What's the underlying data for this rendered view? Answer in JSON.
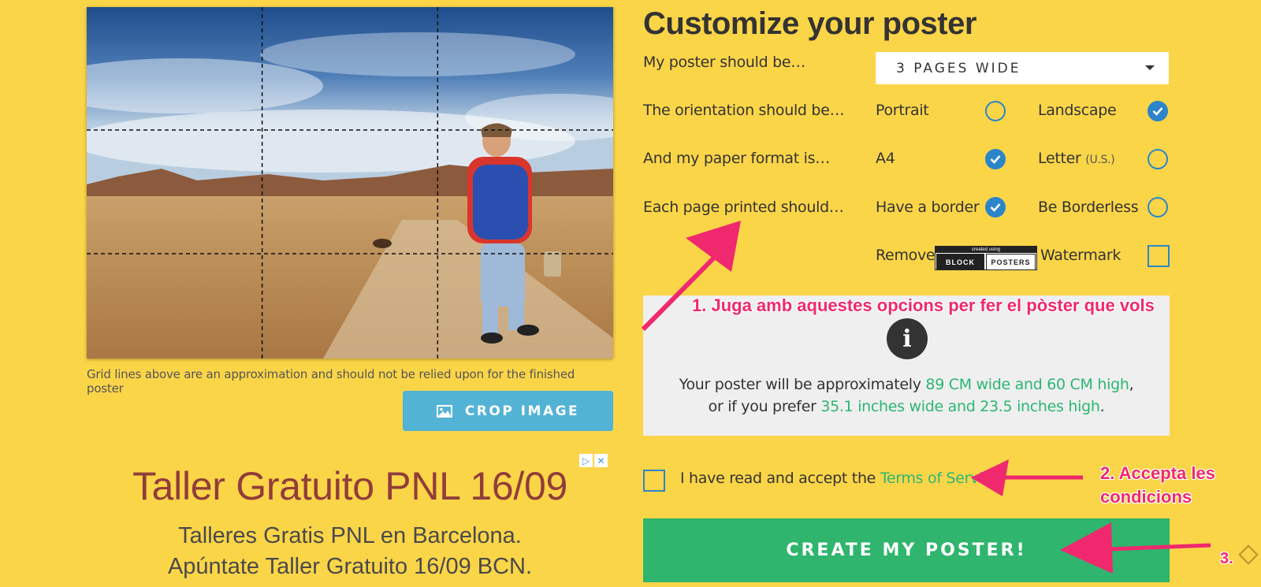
{
  "image": {
    "caption": "Grid lines above are an approximation and should not be relied upon for the finished poster",
    "crop_label": "CROP IMAGE",
    "crop_icon": "image-icon"
  },
  "ad": {
    "title": "Taller Gratuito PNL 16/09",
    "line1": "Talleres Gratis PNL en Barcelona.",
    "line2": "Apúntate Taller Gratuito 16/09 BCN.",
    "choices_icons": [
      "play-triangle-icon",
      "close-icon"
    ]
  },
  "customize": {
    "title": "Customize your poster",
    "size": {
      "label": "My poster should be…",
      "selected": "3 PAGES WIDE"
    },
    "orientation": {
      "label": "The orientation should be…",
      "option1": "Portrait",
      "option1_checked": false,
      "option2": "Landscape",
      "option2_checked": true
    },
    "paper": {
      "label": "And my paper format is…",
      "option1": "A4",
      "option1_checked": true,
      "option2": "Letter",
      "option2_note": "(U.S.)",
      "option2_checked": false
    },
    "border": {
      "label": "Each page printed should…",
      "option1": "Have a border",
      "option1_checked": true,
      "option2": "Be Borderless",
      "option2_checked": false
    },
    "watermark": {
      "remove": "Remove",
      "badge_top": "created using",
      "badge_left": "BLOCK",
      "badge_right": "POSTERS",
      "label": "Watermark",
      "checked": false
    }
  },
  "info": {
    "icon": "info-icon",
    "line1_prefix": "Your poster will be approximately ",
    "line1_highlight": "89 CM wide and 60 CM high",
    "line1_suffix": ",",
    "line2_prefix": "or if you prefer ",
    "line2_highlight": "35.1 inches wide and 23.5 inches high",
    "line2_suffix": "."
  },
  "terms": {
    "prefix": "I have read and accept the ",
    "link": "Terms of Service",
    "checked": false
  },
  "create_label": "CREATE MY POSTER!",
  "annotations": {
    "note1": "1. Juga amb aquestes opcions per fer el pòster que vols",
    "note2_line1": "2. Accepta les",
    "note2_line2": "condicions",
    "note3": "3."
  },
  "colors": {
    "background": "#fbd548",
    "accent_blue": "#2d85c9",
    "crop_button": "#52b3d5",
    "green": "#2bb673",
    "annotation": "#f0286e"
  }
}
